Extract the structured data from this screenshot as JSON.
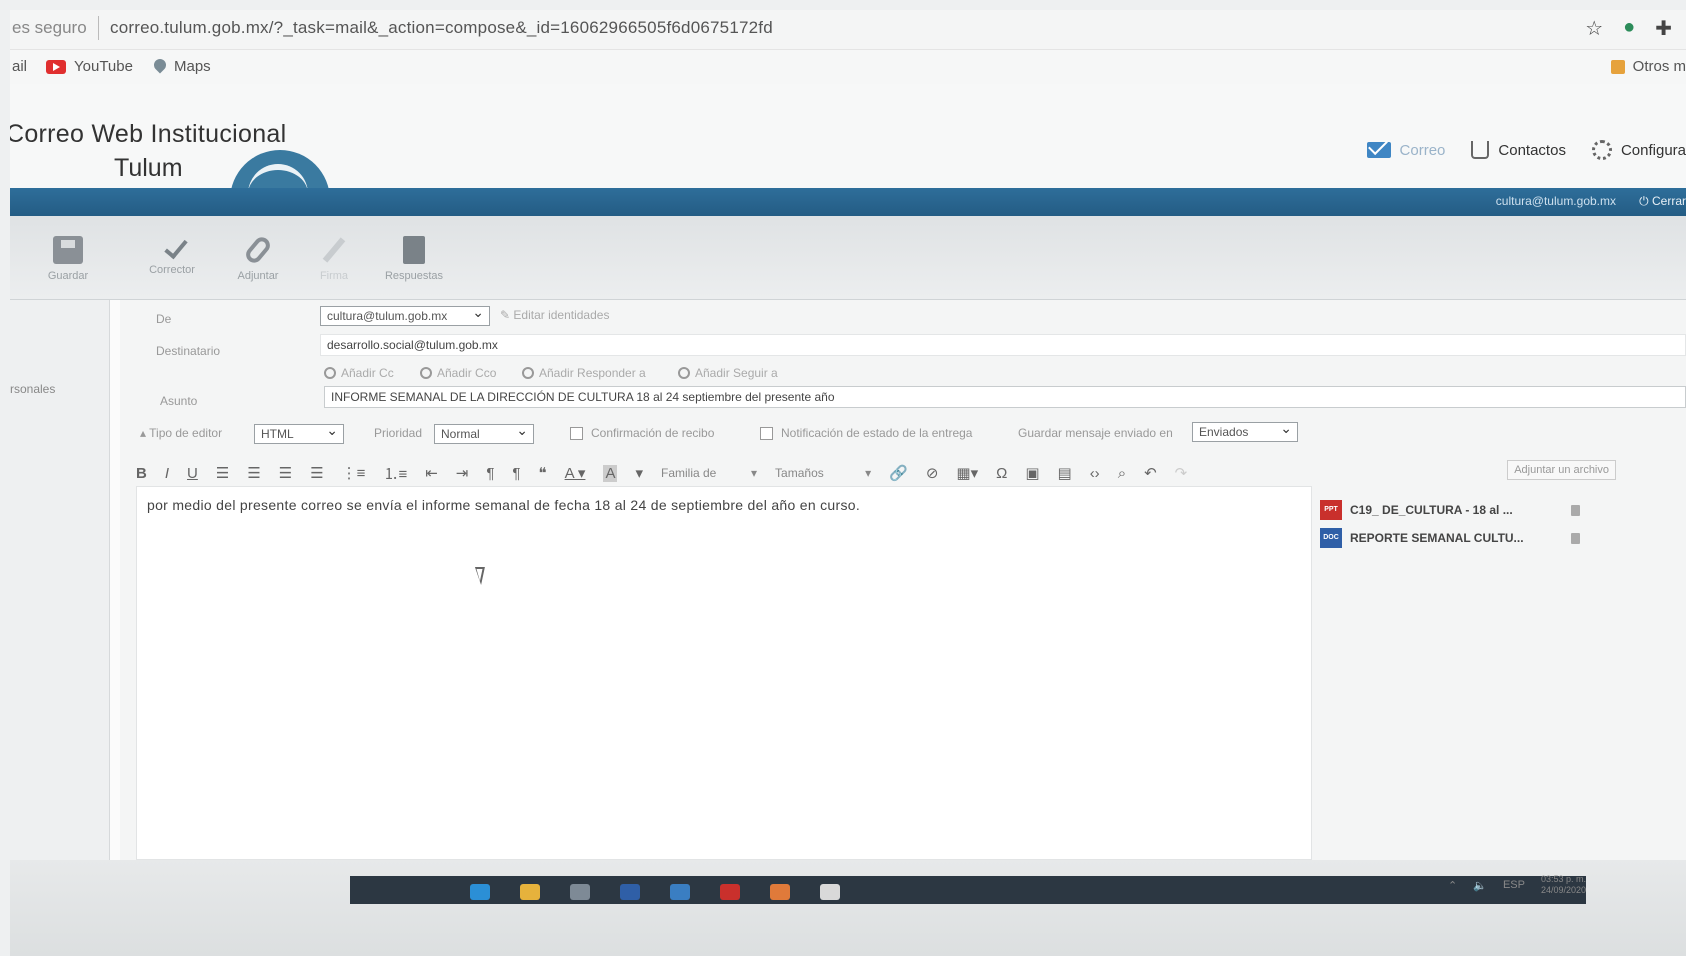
{
  "browser": {
    "security_label": "es seguro",
    "url": "correo.tulum.gob.mx/?_task=mail&_action=compose&_id=16062966505f6d0675172fd",
    "icons": [
      "star-icon",
      "extension-icon",
      "puzzle-icon"
    ]
  },
  "bookmarks": [
    {
      "label": "ail",
      "icon": "none"
    },
    {
      "label": "YouTube",
      "icon": "youtube-icon"
    },
    {
      "label": "Maps",
      "icon": "map-pin-icon"
    }
  ],
  "bookmarks_right": {
    "label": "Otros m",
    "icon": "folder-icon"
  },
  "app": {
    "title_line1": "Correo Web Institucional",
    "title_line2": "Tulum",
    "nav": {
      "mail": "Correo",
      "contacts": "Contactos",
      "settings": "Configura"
    },
    "user_email": "cultura@tulum.gob.mx",
    "logout": "Cerrar"
  },
  "toolbar": {
    "save": "Guardar",
    "spell": "Corrector",
    "attach": "Adjuntar",
    "sign": "Firma",
    "responses": "Respuestas"
  },
  "sidebar": {
    "label": "rsonales"
  },
  "compose": {
    "from_label": "De",
    "from_value": "cultura@tulum.gob.mx",
    "edit_identities": "Editar identidades",
    "to_label": "Destinatario",
    "to_value": "desarrollo.social@tulum.gob.mx",
    "add_cc": "Añadir Cc",
    "add_bcc": "Añadir Cco",
    "add_reply_to": "Añadir Responder a",
    "add_followup": "Añadir Seguir a",
    "subject_label": "Asunto",
    "subject_value": "INFORME SEMANAL DE LA DIRECCIÓN DE CULTURA 18 al 24 septiembre del presente año",
    "editor_type_label": "Tipo de editor",
    "editor_type_value": "HTML",
    "priority_label": "Prioridad",
    "priority_value": "Normal",
    "read_receipt": "Confirmación de recibo",
    "delivery_status": "Notificación de estado de la entrega",
    "save_sent_label": "Guardar mensaje enviado en",
    "save_sent_value": "Enviados",
    "font_family": "Familia de",
    "font_size": "Tamaños",
    "attach_file_button": "Adjuntar un archivo",
    "body": "por medio del presente correo se envía el informe semanal de fecha 18 al 24 de septiembre del año en curso."
  },
  "attachments": [
    {
      "name": "C19_ DE_CULTURA - 18 al ...",
      "type": "PPT"
    },
    {
      "name": "REPORTE SEMANAL CULTU...",
      "type": "DOC"
    }
  ],
  "taskbar": {
    "language": "ESP",
    "time": "03:53 p. m.",
    "date": "24/09/2020"
  }
}
